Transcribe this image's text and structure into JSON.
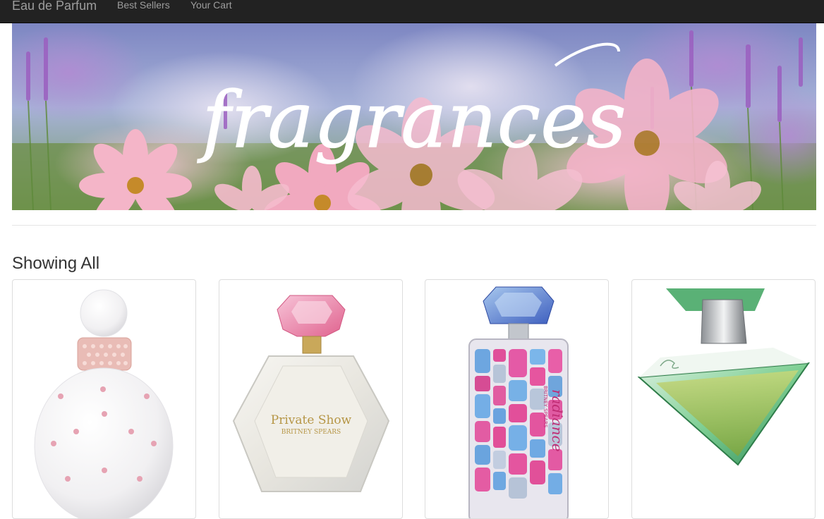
{
  "navbar": {
    "brand": "Eau de Parfum",
    "links": [
      {
        "label": "Best Sellers"
      },
      {
        "label": "Your Cart"
      }
    ],
    "background": "#222222",
    "link_color": "#9d9d9d"
  },
  "hero": {
    "script_text": "fragrances"
  },
  "main": {
    "section_title": "Showing All"
  },
  "products": [
    {
      "icon": "white-perfume-bottle-icon",
      "label_line1": "",
      "label_line2": ""
    },
    {
      "icon": "clear-perfume-bottle-icon",
      "label_line1": "Private Show",
      "label_line2": "BRITNEY SPEARS"
    },
    {
      "icon": "jeweled-perfume-bottle-icon",
      "label_line1": "radiance",
      "label_line2": "BRITNEY SPEARS"
    },
    {
      "icon": "green-perfume-bottle-icon",
      "label_line1": "",
      "label_line2": ""
    }
  ]
}
